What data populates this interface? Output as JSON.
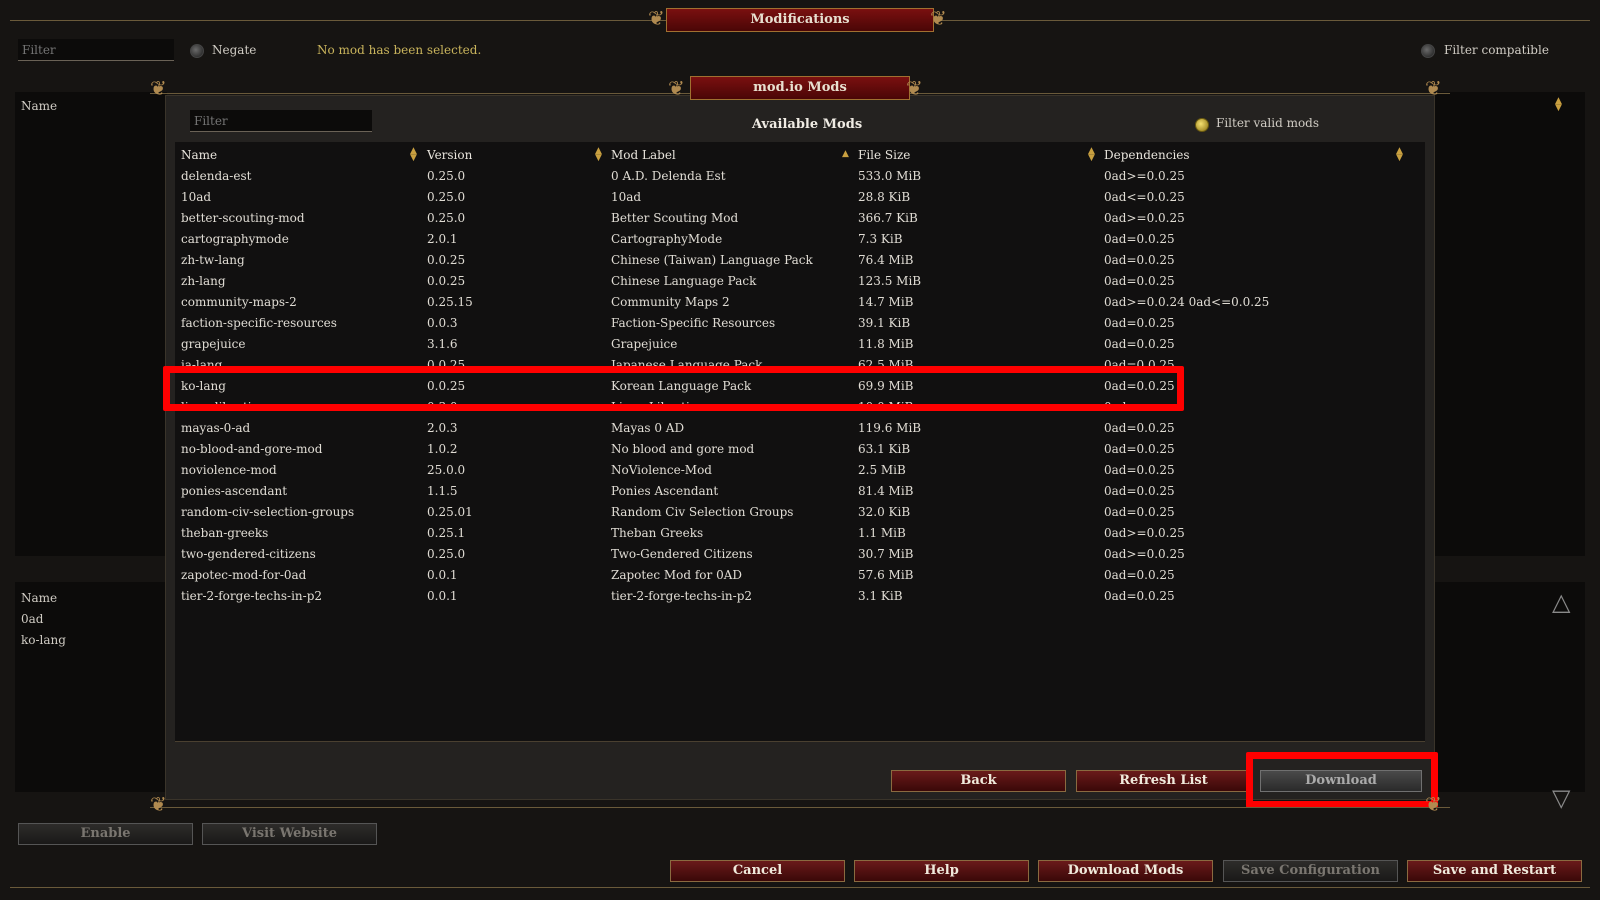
{
  "window": {
    "title": "Modifications"
  },
  "top_bar": {
    "filter_placeholder": "Filter",
    "negate_label": "Negate",
    "status_text": "No mod has been selected.",
    "filter_compatible_label": "Filter compatible"
  },
  "left_panel": {
    "name_header": "Name",
    "enabled_header": "Name",
    "enabled_items": [
      "0ad",
      "ko-lang"
    ]
  },
  "dialog": {
    "title": "mod.io Mods",
    "filter_placeholder": "Filter",
    "heading": "Available Mods",
    "filter_valid_label": "Filter valid mods",
    "columns": [
      "Name",
      "Version",
      "Mod Label",
      "File Size",
      "Dependencies"
    ],
    "rows": [
      {
        "name": "delenda-est",
        "version": "0.25.0",
        "label": "0 A.D. Delenda Est",
        "size": "533.0 MiB",
        "deps": "0ad>=0.0.25"
      },
      {
        "name": "10ad",
        "version": "0.25.0",
        "label": "10ad",
        "size": "28.8 KiB",
        "deps": "0ad<=0.0.25"
      },
      {
        "name": "better-scouting-mod",
        "version": "0.25.0",
        "label": "Better Scouting Mod",
        "size": "366.7 KiB",
        "deps": "0ad>=0.0.25"
      },
      {
        "name": "cartographymode",
        "version": "2.0.1",
        "label": "CartographyMode",
        "size": "7.3 KiB",
        "deps": "0ad=0.0.25"
      },
      {
        "name": "zh-tw-lang",
        "version": "0.0.25",
        "label": "Chinese (Taiwan) Language Pack",
        "size": "76.4 MiB",
        "deps": "0ad=0.0.25"
      },
      {
        "name": "zh-lang",
        "version": "0.0.25",
        "label": "Chinese Language Pack",
        "size": "123.5 MiB",
        "deps": "0ad=0.0.25"
      },
      {
        "name": "community-maps-2",
        "version": "0.25.15",
        "label": "Community Maps 2",
        "size": "14.7 MiB",
        "deps": "0ad>=0.0.24 0ad<=0.0.25"
      },
      {
        "name": "faction-specific-resources",
        "version": "0.0.3",
        "label": "Faction-Specific Resources",
        "size": "39.1 KiB",
        "deps": "0ad=0.0.25"
      },
      {
        "name": "grapejuice",
        "version": "3.1.6",
        "label": "Grapejuice",
        "size": "11.8 MiB",
        "deps": "0ad=0.0.25"
      },
      {
        "name": "ja-lang",
        "version": "0.0.25",
        "label": "Japanese Language Pack",
        "size": "62.5 MiB",
        "deps": "0ad=0.0.25"
      },
      {
        "name": "ko-lang",
        "version": "0.0.25",
        "label": "Korean Language Pack",
        "size": "69.9 MiB",
        "deps": "0ad=0.0.25"
      },
      {
        "name": "linux-libertine",
        "version": "0.3.0",
        "label": "Linux Libertine",
        "size": "10.0 MiB",
        "deps": "0ad"
      },
      {
        "name": "mayas-0-ad",
        "version": "2.0.3",
        "label": "Mayas 0 AD",
        "size": "119.6 MiB",
        "deps": "0ad=0.0.25"
      },
      {
        "name": "no-blood-and-gore-mod",
        "version": "1.0.2",
        "label": "No blood and gore mod",
        "size": "63.1 KiB",
        "deps": "0ad=0.0.25"
      },
      {
        "name": "noviolence-mod",
        "version": "25.0.0",
        "label": "NoViolence-Mod",
        "size": "2.5 MiB",
        "deps": "0ad=0.0.25"
      },
      {
        "name": "ponies-ascendant",
        "version": "1.1.5",
        "label": "Ponies Ascendant",
        "size": "81.4 MiB",
        "deps": "0ad=0.0.25"
      },
      {
        "name": "random-civ-selection-groups",
        "version": "0.25.01",
        "label": "Random Civ Selection Groups",
        "size": "32.0 KiB",
        "deps": "0ad=0.0.25"
      },
      {
        "name": "theban-greeks",
        "version": "0.25.1",
        "label": "Theban Greeks",
        "size": "1.1 MiB",
        "deps": "0ad>=0.0.25"
      },
      {
        "name": "two-gendered-citizens",
        "version": "0.25.0",
        "label": "Two-Gendered Citizens",
        "size": "30.7 MiB",
        "deps": "0ad>=0.0.25"
      },
      {
        "name": "zapotec-mod-for-0ad",
        "version": "0.0.1",
        "label": "Zapotec Mod for 0AD",
        "size": "57.6 MiB",
        "deps": "0ad=0.0.25"
      },
      {
        "name": "tier-2-forge-techs-in-p2",
        "version": "0.0.1",
        "label": "tier-2-forge-techs-in-p2",
        "size": "3.1 KiB",
        "deps": "0ad=0.0.25"
      }
    ],
    "buttons": {
      "back": "Back",
      "refresh": "Refresh List",
      "download": "Download"
    }
  },
  "bottom_bar": {
    "enable": "Enable",
    "visit_website": "Visit Website",
    "cancel": "Cancel",
    "help": "Help",
    "download_mods": "Download Mods",
    "save_configuration": "Save Configuration",
    "save_and_restart": "Save and Restart"
  },
  "colors": {
    "highlight_box": "#ff0000",
    "button_red": "#6a1a1a",
    "accent_gold": "#c9a040"
  },
  "icons": [
    "scroll-up-icon",
    "scroll-down-icon",
    "sort-arrows-icon",
    "ornament-icon"
  ]
}
